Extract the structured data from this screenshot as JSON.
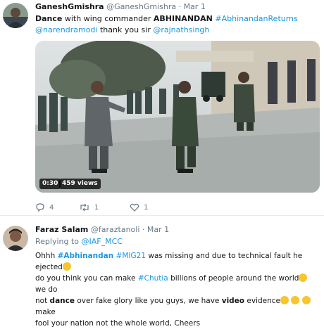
{
  "tweet1": {
    "display_name": "GaneshGmishra",
    "handle": "@GaneshGmishra",
    "sep": "·",
    "date": "Mar 1",
    "text": {
      "t1": "Dance",
      "t2": " with wing commander ",
      "t3": "ABHINANDAN",
      "t4": " ",
      "hashtag": "#AbhinandanReturns",
      "mention1": "@narendramodi",
      "t5": " thank you sir ",
      "mention2": "@rajnathsingh"
    },
    "video": {
      "duration": "0:30",
      "views": "459 views"
    },
    "actions": {
      "reply_count": "4",
      "retweet_count": "1",
      "like_count": "1"
    }
  },
  "tweet2": {
    "display_name": "Faraz Salam",
    "handle": "@faraztanoli",
    "sep": "·",
    "date": "Mar 1",
    "replying_label": "Replying to ",
    "replying_to": "@IAF_MCC",
    "text": {
      "a1": "Ohhh ",
      "h1": "#Abhinandan",
      "a2": " ",
      "h2": "#MIG21",
      "a3": " was missing and due to technical fault he ejected",
      "a4": "do you think you can make ",
      "h3": "#Chutia",
      "a5": " billions of people around the world",
      "a6": " we do",
      "a7": "not ",
      "w1": "dance",
      "a8": " over fake glory like you guys, we have ",
      "w2": "video",
      "a9": " evidence",
      "a10": " make",
      "a11": "fool your nation not the whole world, Cheers"
    }
  },
  "colors": {
    "link": "#1b95e0",
    "text": "#14171a",
    "muted": "#657786",
    "divider": "#e6ecf0",
    "emoji": "#f7c52d"
  },
  "icons": [
    "reply-icon",
    "retweet-icon",
    "like-icon",
    "thinking-emoji",
    "grin-emoji",
    "hug-emoji",
    "smile-emoji"
  ]
}
